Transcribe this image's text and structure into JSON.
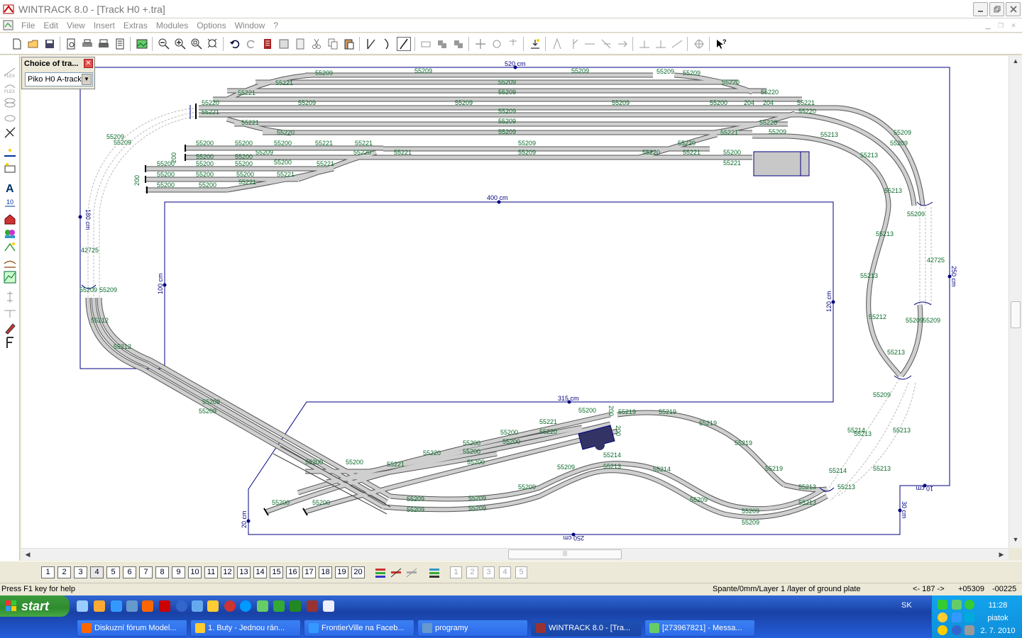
{
  "window": {
    "title": "WINTRACK 8.0 - [Track H0 +.tra]"
  },
  "menu": {
    "items": [
      "File",
      "Edit",
      "View",
      "Insert",
      "Extras",
      "Modules",
      "Options",
      "Window",
      "?"
    ]
  },
  "dialog": {
    "title": "Choice of tra...",
    "selected": "Piko H0 A-track"
  },
  "dims": {
    "top": "520 cm",
    "inner_top": "400 cm",
    "left": "180 cm",
    "inner_left": "100 cm",
    "inner_right": "120 cm",
    "right": "250 cm",
    "bottom_left": "315 cm",
    "bottom": "250 cm",
    "bottom_small_left": "20 cm",
    "bottom_small_right": "30 cm",
    "bottom_right": "10 cm"
  },
  "track_labels": {
    "t55209": "55209",
    "t55221": "55221",
    "t55220": "55220",
    "t55200": "55200",
    "t55213": "55213",
    "t55219": "55219",
    "t55214": "55214",
    "t55212": "55212",
    "t204": "204",
    "t200": "200",
    "t42725": "42725"
  },
  "layers": {
    "numbers": [
      "1",
      "2",
      "3",
      "4",
      "5",
      "6",
      "7",
      "8",
      "9",
      "10",
      "11",
      "12",
      "13",
      "14",
      "15",
      "16",
      "17",
      "18",
      "19",
      "20"
    ],
    "active": "4",
    "extra": [
      "1",
      "2",
      "3",
      "4",
      "5"
    ]
  },
  "status": {
    "help": "Press F1 key for help",
    "info": "Spante/0mm/Layer 1 /layer of ground plate",
    "coord1": "<- 187 ->",
    "coord2": "+05309",
    "coord3": "-00225"
  },
  "taskbar": {
    "start": "start",
    "tasks": [
      "Diskuzní fórum Model...",
      "1. Buty - Jednou rán...",
      "FrontierVille na Faceb...",
      "programy",
      "WINTRACK 8.0 - [Tra...",
      "[273967821] - Messa..."
    ],
    "lang": "SK",
    "time": "11:28",
    "day": "piatok",
    "date": "2. 7. 2010"
  },
  "colors": {
    "track_fill": "#c8c8c8",
    "track_edge": "#555555",
    "label_green": "#0a6b2a",
    "dim_line": "#000080",
    "taskbar": "#245edb",
    "start": "#3c9a3c"
  }
}
